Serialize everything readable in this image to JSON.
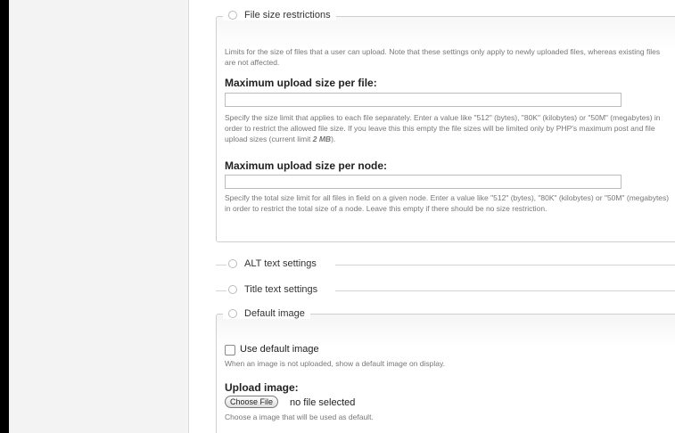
{
  "file_size": {
    "legend": "File size restrictions",
    "description": "Limits for the size of files that a user can upload. Note that these settings only apply to newly uploaded files, whereas existing files are not affected.",
    "per_file": {
      "label": "Maximum upload size per file:",
      "value": "",
      "help": "Specify the size limit that applies to each file separately. Enter a value like \"512\" (bytes), \"80K\" (kilobytes) or \"50M\" (megabytes) in order to restrict the allowed file size. If you leave this this empty the file sizes will be limited only by PHP's maximum post and file upload sizes (current limit",
      "limit": "2 MB",
      "help_end": ")."
    },
    "per_node": {
      "label": "Maximum upload size per node:",
      "value": "",
      "help": "Specify the total size limit for all files in field on a given node. Enter a value like \"512\" (bytes), \"80K\" (kilobytes) or \"50M\" (megabytes) in order to restrict the total size of a node. Leave this empty if there should be no size restriction."
    }
  },
  "alt_text": {
    "legend": "ALT text settings"
  },
  "title_text": {
    "legend": "Title text settings"
  },
  "default_image": {
    "legend": "Default image",
    "use_default_label": "Use default image",
    "use_default_checked": false,
    "use_default_help": "When an image is not uploaded, show a default image on display.",
    "upload_label": "Upload image:",
    "choose_button": "Choose File",
    "no_file": "no file selected",
    "upload_help": "Choose a image that will be used as default."
  },
  "colors": {
    "border": "#cfcfcf",
    "help_text": "#777777",
    "sidebar": "#f3f3f3"
  }
}
